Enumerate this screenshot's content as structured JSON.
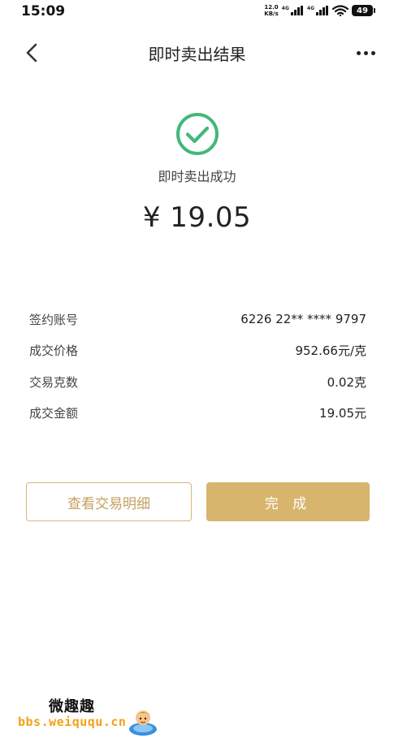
{
  "status_bar": {
    "time": "15:09",
    "net_speed_value": "12.0",
    "net_speed_unit": "KB/s",
    "signal1_label": "4G",
    "signal2_label": "4G",
    "battery": "49"
  },
  "nav": {
    "title": "即时卖出结果",
    "back_icon": "chevron-left-icon",
    "more_icon": "more-horizontal-icon"
  },
  "result": {
    "status_icon": "check-circle-icon",
    "status_color": "#43b879",
    "status_text": "即时卖出成功",
    "amount": "¥ 19.05"
  },
  "details": [
    {
      "label": "签约账号",
      "value": "6226 22** **** 9797"
    },
    {
      "label": "成交价格",
      "value": "952.66元/克"
    },
    {
      "label": "交易克数",
      "value": "0.02克"
    },
    {
      "label": "成交金额",
      "value": "19.05元"
    }
  ],
  "actions": {
    "detail_label": "查看交易明细",
    "done_label": "完 成",
    "accent_color": "#d7b56d"
  },
  "watermark": {
    "brand": "微趣趣",
    "url": "bbs.weiququ.cn"
  }
}
